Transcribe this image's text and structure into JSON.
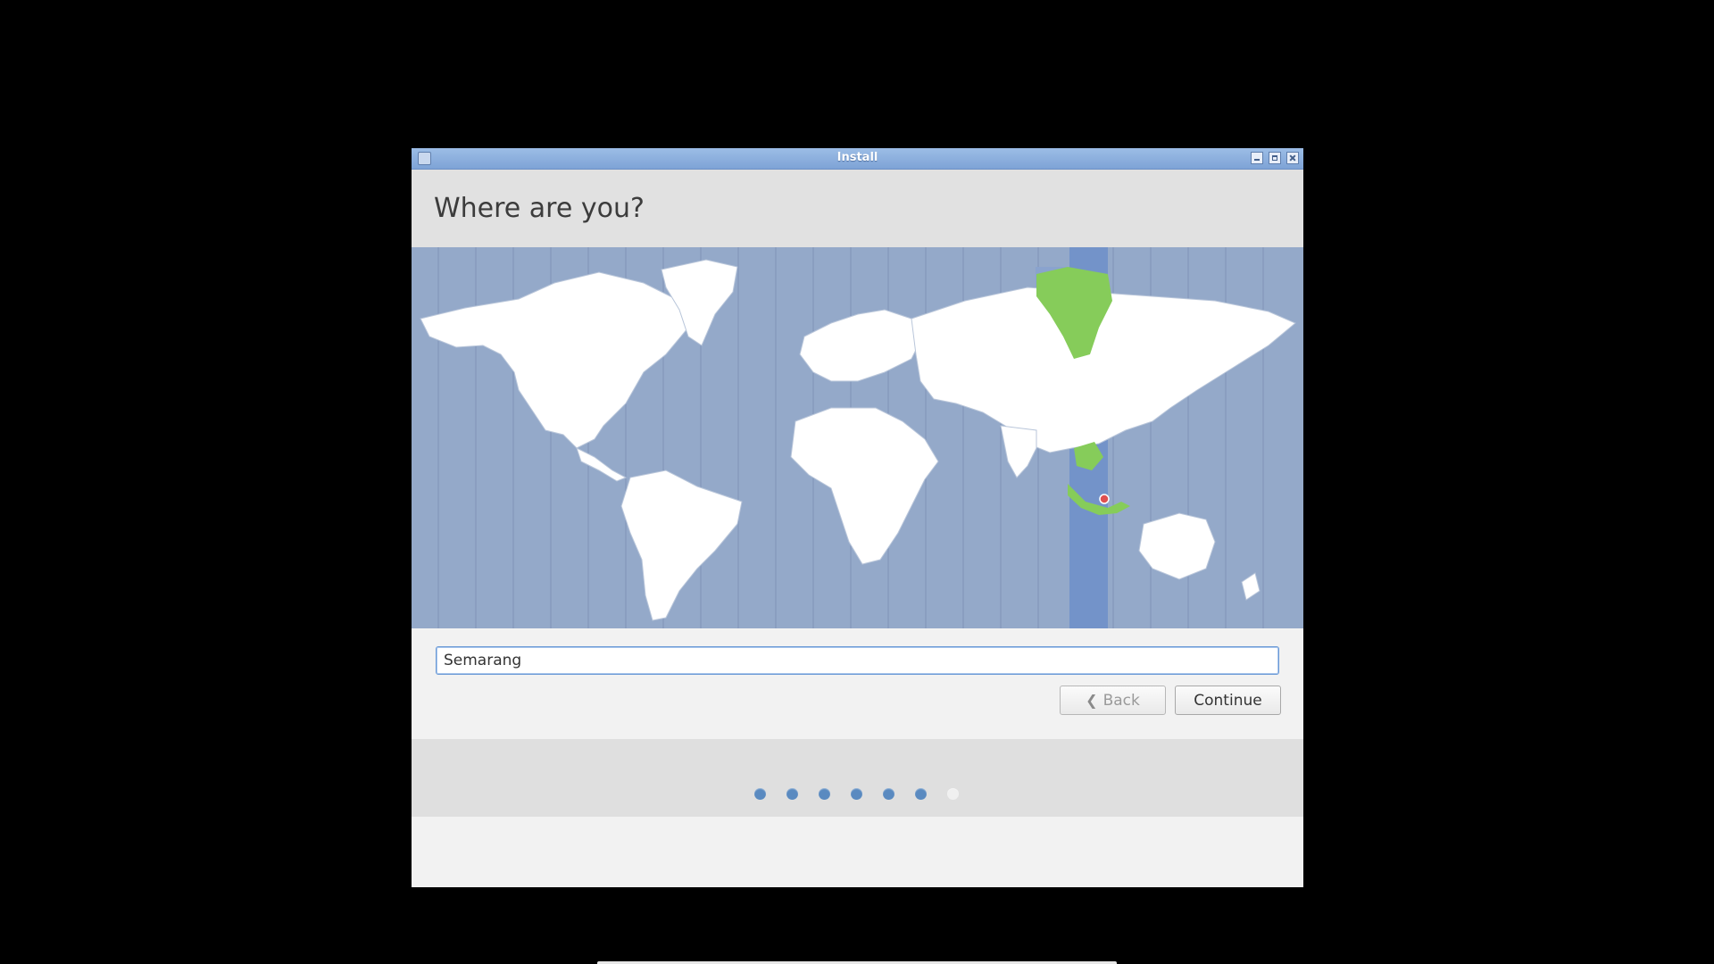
{
  "window": {
    "title": "Install",
    "icon": "installer-icon"
  },
  "header": {
    "heading": "Where are you?"
  },
  "map": {
    "selected_timezone_highlight": "#86cc5a",
    "marker_color": "#e05050"
  },
  "location": {
    "value": "Semarang"
  },
  "buttons": {
    "back_label": "Back",
    "continue_label": "Continue"
  },
  "progress": {
    "current_step": 6,
    "total_steps": 7
  }
}
